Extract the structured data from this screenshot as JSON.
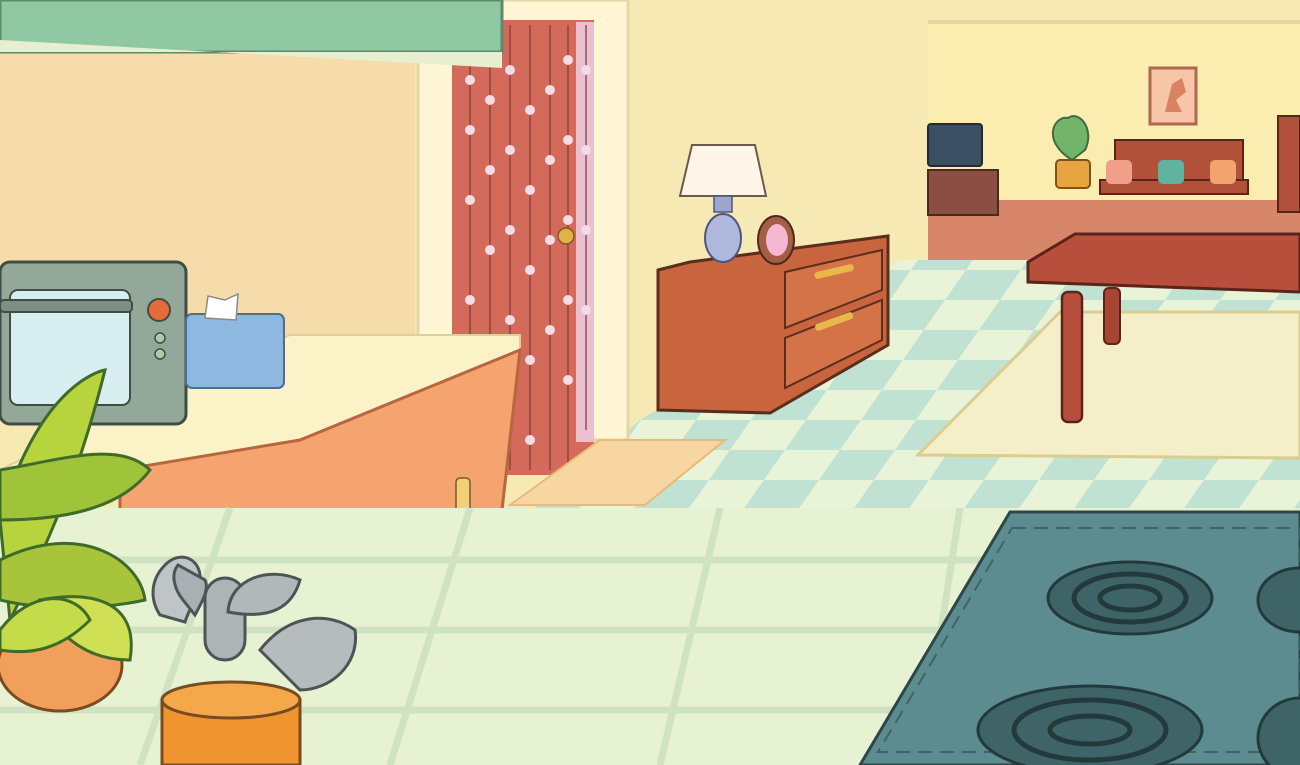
{
  "scene": {
    "kind": "illustrated-kitchen-background",
    "objects": [
      "range-hood",
      "toaster-oven",
      "tissue-box",
      "kitchen-counter",
      "lower-cabinet",
      "doorway",
      "seashell-bead-curtain",
      "doormat",
      "table-lamp",
      "hand-mirror",
      "dresser",
      "checkered-floor",
      "area-rug",
      "dining-table",
      "tv-stand",
      "television",
      "potted-plant",
      "wooden-bench",
      "framed-horse-picture",
      "staircase-railing",
      "countertop",
      "potted-leafy-plant",
      "utensil-crock",
      "stovetop"
    ]
  },
  "palette": {
    "wall": "#f7e9b4",
    "wall_shadow": "#f5d9a6",
    "hood": "#8fc8a2",
    "counter": "#fbf2c8",
    "cabinet": "#f5a36f",
    "curtain": "#d46a5a",
    "wood": "#c8653f",
    "floor_light": "#e9f3d8",
    "floor_dark": "#bfe2d2",
    "rug": "#f5efc9",
    "stove": "#5c8c90",
    "burner": "#3f6468",
    "outline": "#4a3328"
  }
}
